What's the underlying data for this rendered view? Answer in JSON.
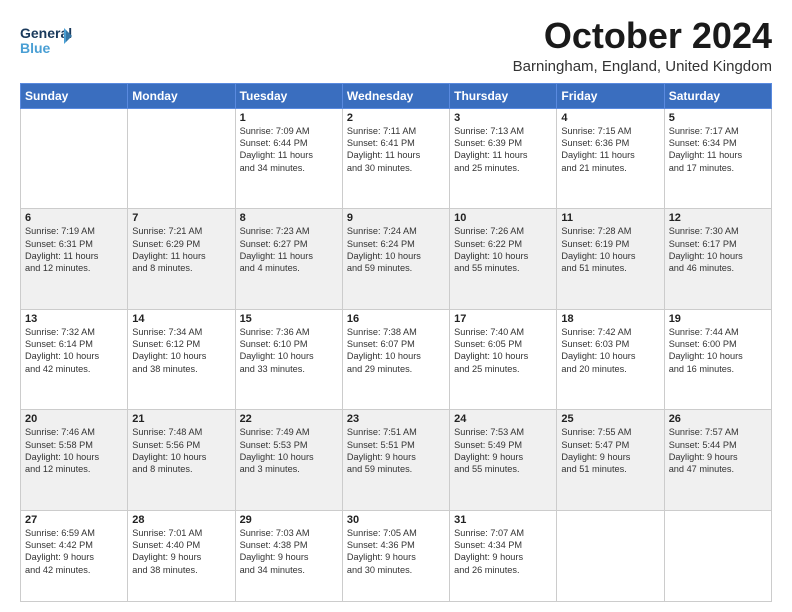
{
  "logo": {
    "line1": "General",
    "line2": "Blue",
    "icon_color": "#4a9fd4"
  },
  "header": {
    "month": "October 2024",
    "location": "Barningham, England, United Kingdom"
  },
  "weekdays": [
    "Sunday",
    "Monday",
    "Tuesday",
    "Wednesday",
    "Thursday",
    "Friday",
    "Saturday"
  ],
  "weeks": [
    [
      {
        "day": "",
        "info": ""
      },
      {
        "day": "",
        "info": ""
      },
      {
        "day": "1",
        "info": "Sunrise: 7:09 AM\nSunset: 6:44 PM\nDaylight: 11 hours\nand 34 minutes."
      },
      {
        "day": "2",
        "info": "Sunrise: 7:11 AM\nSunset: 6:41 PM\nDaylight: 11 hours\nand 30 minutes."
      },
      {
        "day": "3",
        "info": "Sunrise: 7:13 AM\nSunset: 6:39 PM\nDaylight: 11 hours\nand 25 minutes."
      },
      {
        "day": "4",
        "info": "Sunrise: 7:15 AM\nSunset: 6:36 PM\nDaylight: 11 hours\nand 21 minutes."
      },
      {
        "day": "5",
        "info": "Sunrise: 7:17 AM\nSunset: 6:34 PM\nDaylight: 11 hours\nand 17 minutes."
      }
    ],
    [
      {
        "day": "6",
        "info": "Sunrise: 7:19 AM\nSunset: 6:31 PM\nDaylight: 11 hours\nand 12 minutes."
      },
      {
        "day": "7",
        "info": "Sunrise: 7:21 AM\nSunset: 6:29 PM\nDaylight: 11 hours\nand 8 minutes."
      },
      {
        "day": "8",
        "info": "Sunrise: 7:23 AM\nSunset: 6:27 PM\nDaylight: 11 hours\nand 4 minutes."
      },
      {
        "day": "9",
        "info": "Sunrise: 7:24 AM\nSunset: 6:24 PM\nDaylight: 10 hours\nand 59 minutes."
      },
      {
        "day": "10",
        "info": "Sunrise: 7:26 AM\nSunset: 6:22 PM\nDaylight: 10 hours\nand 55 minutes."
      },
      {
        "day": "11",
        "info": "Sunrise: 7:28 AM\nSunset: 6:19 PM\nDaylight: 10 hours\nand 51 minutes."
      },
      {
        "day": "12",
        "info": "Sunrise: 7:30 AM\nSunset: 6:17 PM\nDaylight: 10 hours\nand 46 minutes."
      }
    ],
    [
      {
        "day": "13",
        "info": "Sunrise: 7:32 AM\nSunset: 6:14 PM\nDaylight: 10 hours\nand 42 minutes."
      },
      {
        "day": "14",
        "info": "Sunrise: 7:34 AM\nSunset: 6:12 PM\nDaylight: 10 hours\nand 38 minutes."
      },
      {
        "day": "15",
        "info": "Sunrise: 7:36 AM\nSunset: 6:10 PM\nDaylight: 10 hours\nand 33 minutes."
      },
      {
        "day": "16",
        "info": "Sunrise: 7:38 AM\nSunset: 6:07 PM\nDaylight: 10 hours\nand 29 minutes."
      },
      {
        "day": "17",
        "info": "Sunrise: 7:40 AM\nSunset: 6:05 PM\nDaylight: 10 hours\nand 25 minutes."
      },
      {
        "day": "18",
        "info": "Sunrise: 7:42 AM\nSunset: 6:03 PM\nDaylight: 10 hours\nand 20 minutes."
      },
      {
        "day": "19",
        "info": "Sunrise: 7:44 AM\nSunset: 6:00 PM\nDaylight: 10 hours\nand 16 minutes."
      }
    ],
    [
      {
        "day": "20",
        "info": "Sunrise: 7:46 AM\nSunset: 5:58 PM\nDaylight: 10 hours\nand 12 minutes."
      },
      {
        "day": "21",
        "info": "Sunrise: 7:48 AM\nSunset: 5:56 PM\nDaylight: 10 hours\nand 8 minutes."
      },
      {
        "day": "22",
        "info": "Sunrise: 7:49 AM\nSunset: 5:53 PM\nDaylight: 10 hours\nand 3 minutes."
      },
      {
        "day": "23",
        "info": "Sunrise: 7:51 AM\nSunset: 5:51 PM\nDaylight: 9 hours\nand 59 minutes."
      },
      {
        "day": "24",
        "info": "Sunrise: 7:53 AM\nSunset: 5:49 PM\nDaylight: 9 hours\nand 55 minutes."
      },
      {
        "day": "25",
        "info": "Sunrise: 7:55 AM\nSunset: 5:47 PM\nDaylight: 9 hours\nand 51 minutes."
      },
      {
        "day": "26",
        "info": "Sunrise: 7:57 AM\nSunset: 5:44 PM\nDaylight: 9 hours\nand 47 minutes."
      }
    ],
    [
      {
        "day": "27",
        "info": "Sunrise: 6:59 AM\nSunset: 4:42 PM\nDaylight: 9 hours\nand 42 minutes."
      },
      {
        "day": "28",
        "info": "Sunrise: 7:01 AM\nSunset: 4:40 PM\nDaylight: 9 hours\nand 38 minutes."
      },
      {
        "day": "29",
        "info": "Sunrise: 7:03 AM\nSunset: 4:38 PM\nDaylight: 9 hours\nand 34 minutes."
      },
      {
        "day": "30",
        "info": "Sunrise: 7:05 AM\nSunset: 4:36 PM\nDaylight: 9 hours\nand 30 minutes."
      },
      {
        "day": "31",
        "info": "Sunrise: 7:07 AM\nSunset: 4:34 PM\nDaylight: 9 hours\nand 26 minutes."
      },
      {
        "day": "",
        "info": ""
      },
      {
        "day": "",
        "info": ""
      }
    ]
  ]
}
